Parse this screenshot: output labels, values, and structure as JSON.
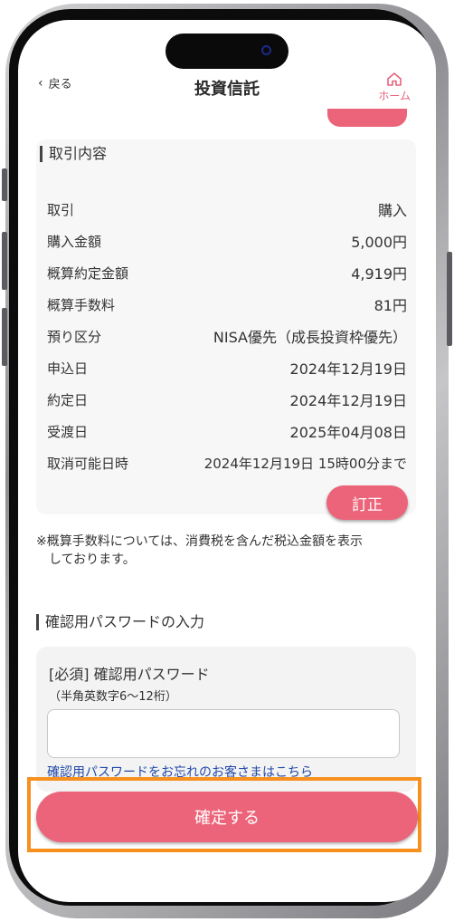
{
  "header": {
    "back_label": "戻る",
    "title": "投資信託",
    "home_label": "ホーム"
  },
  "transaction": {
    "heading": "取引内容",
    "rows": [
      {
        "label": "取引",
        "value": "購入"
      },
      {
        "label": "購入金額",
        "value": "5,000円"
      },
      {
        "label": "概算約定金額",
        "value": "4,919円"
      },
      {
        "label": "概算手数料",
        "value": "81円"
      },
      {
        "label": "預り区分",
        "value": "NISA優先（成長投資枠優先）"
      },
      {
        "label": "申込日",
        "value": "2024年12月19日"
      },
      {
        "label": "約定日",
        "value": "2024年12月19日"
      },
      {
        "label": "受渡日",
        "value": "2025年04月08日"
      },
      {
        "label": "取消可能日時",
        "value": "2024年12月19日 15時00分まで"
      }
    ],
    "edit_label": "訂正"
  },
  "note": {
    "line1": "※概算手数料については、消費税を含んだ税込金額を表示",
    "line2": "しております。"
  },
  "password": {
    "heading": "確認用パスワードの入力",
    "label": "[必須] 確認用パスワード",
    "sub": "（半角英数字6～12桁）",
    "value": "",
    "forgot_link": "確認用パスワードをお忘れのお客さまはこちら"
  },
  "confirm_label": "確定する",
  "colors": {
    "accent": "#ec6479",
    "highlight": "#f7901e",
    "link": "#2048a8"
  }
}
